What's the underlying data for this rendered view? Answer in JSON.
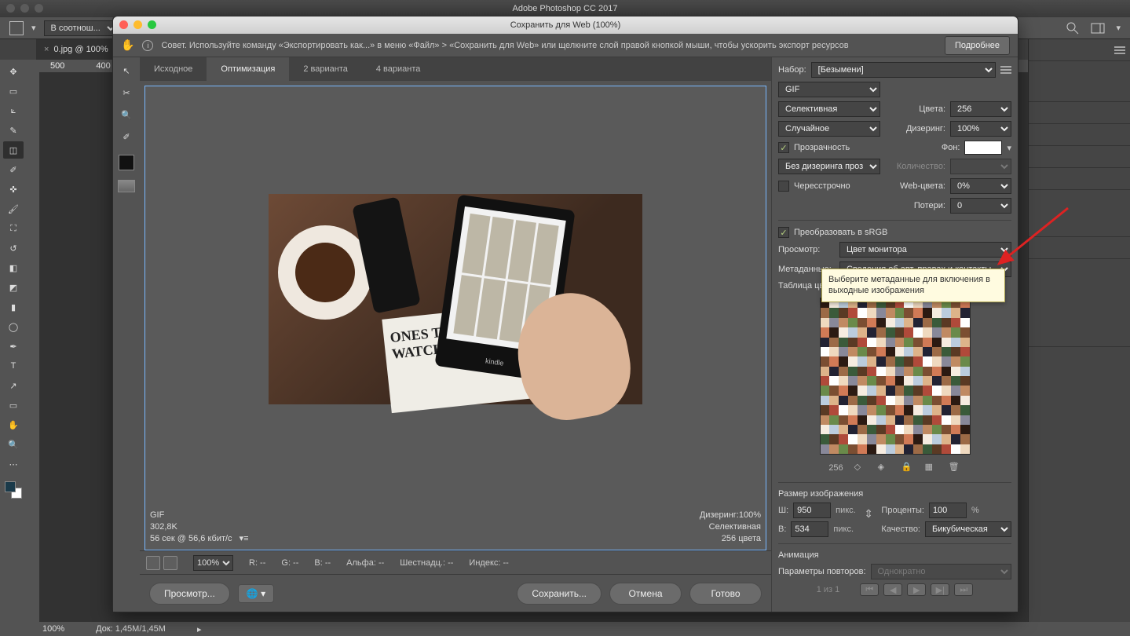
{
  "app": {
    "title": "Adobe Photoshop CC 2017"
  },
  "optionsbar": {
    "ratio": "В соотнош..."
  },
  "doc_tab": {
    "name": "0.jpg @ 100%"
  },
  "ruler": {
    "marks": [
      "500",
      "400"
    ]
  },
  "status": {
    "zoom": "100%",
    "doc": "Док: 1,45M/1,45M"
  },
  "dialog": {
    "title": "Сохранить для Web (100%)",
    "tip": "Совет. Используйте команду «Экспортировать как...» в меню «Файл» > «Сохранить для Web» или щелкните слой правой кнопкой мыши, чтобы ускорить экспорт ресурсов",
    "more": "Подробнее",
    "tabs": {
      "t1": "Исходное",
      "t2": "Оптимизация",
      "t3": "2 варианта",
      "t4": "4 варианта"
    },
    "preview_meta": {
      "fmt": "GIF",
      "size": "302,8K",
      "time": "56 сек @ 56,6 кбит/с",
      "dither": "Дизеринг:100%",
      "palette": "Селективная",
      "colors": "256 цвета"
    },
    "status_row": {
      "zoom": "100%",
      "r": "R: --",
      "g": "G: --",
      "b": "B: --",
      "alpha": "Альфа: --",
      "hex": "Шестнадц.: --",
      "index": "Индекс: --"
    },
    "buttons": {
      "preview": "Просмотр...",
      "save": "Сохранить...",
      "cancel": "Отмена",
      "done": "Готово"
    }
  },
  "settings": {
    "preset_lbl": "Набор:",
    "preset": "[Безымени]",
    "format": "GIF",
    "reduction": "Селективная",
    "colors_lbl": "Цвета:",
    "colors": "256",
    "dither_algo": "Случайное",
    "dither_lbl": "Дизеринг:",
    "dither": "100%",
    "transparency": "Прозрачность",
    "matte_lbl": "Фон:",
    "trans_dither": "Без дизеринга проз...",
    "amount_lbl": "Количество:",
    "interlaced": "Чересстрочно",
    "websnap_lbl": "Web-цвета:",
    "websnap": "0%",
    "lossy_lbl": "Потери:",
    "lossy": "0",
    "srgb": "Преобразовать в sRGB",
    "preview_lbl": "Просмотр:",
    "preview": "Цвет монитора",
    "metadata_lbl": "Метаданные:",
    "metadata": "Сведения об авт. правах и контакты",
    "ctable": "Таблица цвет",
    "ctable_count": "256",
    "imgsize": "Размер изображения",
    "w_lbl": "Ш:",
    "w": "950",
    "h_lbl": "В:",
    "h": "534",
    "px": "пикс.",
    "percent_lbl": "Проценты:",
    "percent": "100",
    "pct": "%",
    "quality_lbl": "Качество:",
    "quality": "Бикубическая",
    "anim": "Анимация",
    "loop_lbl": "Параметры повторов:",
    "loop": "Однократно",
    "frame": "1 из 1"
  },
  "tooltip": "Выберите метаданные для включения в выходные изображения",
  "kindle": "kindle",
  "mag_title": "ONES T\nWATCH"
}
